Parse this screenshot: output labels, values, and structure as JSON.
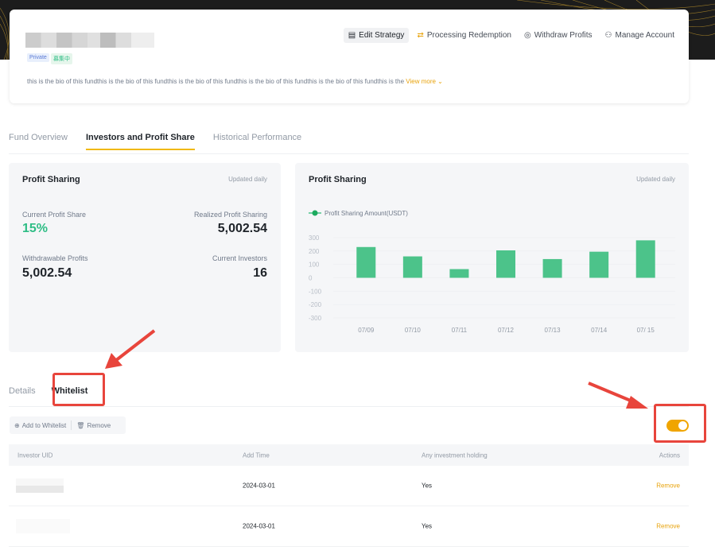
{
  "header": {
    "tags": [
      "Private",
      "募集中"
    ],
    "actions": [
      {
        "label": "Edit Strategy",
        "icon": "edit-icon"
      },
      {
        "label": "Processing Redemption",
        "icon": "redemption-icon"
      },
      {
        "label": "Withdraw Profits",
        "icon": "withdraw-icon"
      },
      {
        "label": "Manage Account",
        "icon": "users-icon"
      }
    ],
    "bio": "this is the bio of this fundthis is the bio of this fundthis is the bio of this fundthis is the bio of this fundthis is the bio of this fundthis is the",
    "view_more": "View more"
  },
  "tabs": [
    "Fund Overview",
    "Investors and Profit Share",
    "Historical Performance"
  ],
  "stats": {
    "title": "Profit Sharing",
    "updated": "Updated daily",
    "current_profit_share_label": "Current Profit Share",
    "current_profit_share": "15%",
    "realized_label": "Realized Profit Sharing",
    "realized": "5,002.54",
    "withdrawable_label": "Withdrawable Profits",
    "withdrawable": "5,002.54",
    "investors_label": "Current Investors",
    "investors": "16"
  },
  "chart_panel": {
    "title": "Profit Sharing",
    "updated": "Updated daily"
  },
  "chart_data": {
    "type": "bar",
    "categories": [
      "07/09",
      "07/10",
      "07/11",
      "07/12",
      "07/13",
      "07/14",
      "07/ 15"
    ],
    "series": [
      {
        "name": "Profit Sharing Amount(USDT)",
        "values": [
          230,
          160,
          65,
          205,
          140,
          195,
          280
        ]
      }
    ],
    "yticks": [
      "300",
      "200",
      "100",
      "0",
      "-100",
      "-200",
      "-300"
    ],
    "ylim": [
      -300,
      300
    ],
    "color": "#4cc38a",
    "grid": true,
    "legend": "top-left"
  },
  "subtabs": [
    "Details",
    "Whitelist"
  ],
  "toolbar": {
    "add": "Add to Whitelist",
    "remove": "Remove"
  },
  "toggle": {
    "on": true,
    "color": "#f0a500"
  },
  "table": {
    "headers": [
      "Investor UID",
      "Add Time",
      "Any investment holding",
      "Actions"
    ],
    "rows": [
      {
        "time": "2024-03-01",
        "holding": "Yes",
        "action": "Remove"
      },
      {
        "time": "2024-03-01",
        "holding": "Yes",
        "action": "Remove"
      }
    ]
  }
}
